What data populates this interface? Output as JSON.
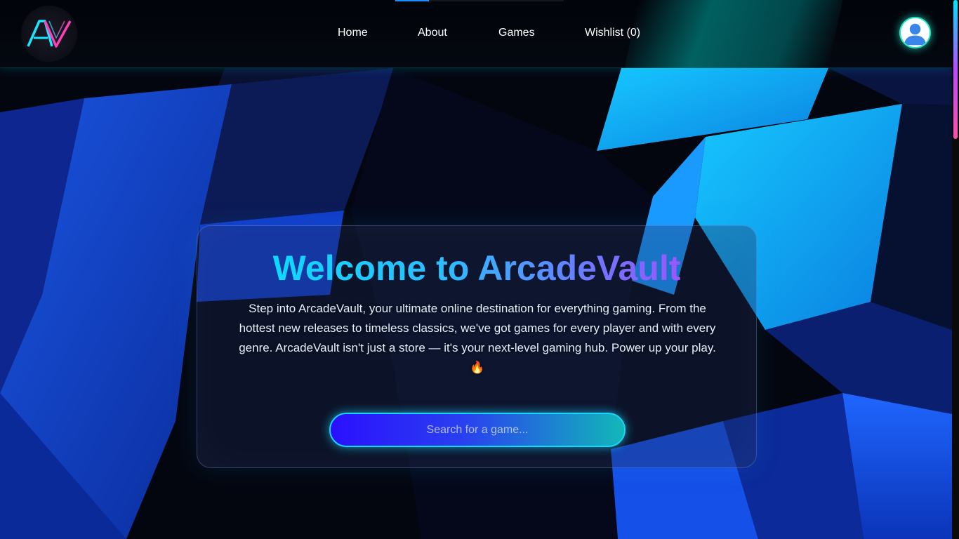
{
  "app": {
    "name": "ArcadeVault"
  },
  "colors": {
    "accent_cyan": "#00e5ff",
    "accent_purple": "#c63cff",
    "accent_teal": "#1ee4c4",
    "search_gradient_start": "#2b10ff",
    "search_gradient_end": "#12b8b8",
    "background": "#05070f"
  },
  "navbar": {
    "logo_icon": "arcadevault-logo-icon",
    "links": [
      {
        "label": "Home"
      },
      {
        "label": "About"
      },
      {
        "label": "Games"
      },
      {
        "label": "Wishlist (0)"
      }
    ],
    "avatar_icon": "user-avatar-icon",
    "progress_fraction": 0.2
  },
  "hero": {
    "title": "Welcome to ArcadeVault",
    "description": "Step into ArcadeVault, your ultimate online destination for everything gaming. From the hottest new releases to timeless classics, we've got games for every player and with every genre. ArcadeVault isn't just a store — it's your next-level gaming hub. Power up your play. 🔥",
    "search": {
      "placeholder": "Search for a game...",
      "value": ""
    }
  },
  "scrollbar": {
    "position_fraction": 0.0
  }
}
